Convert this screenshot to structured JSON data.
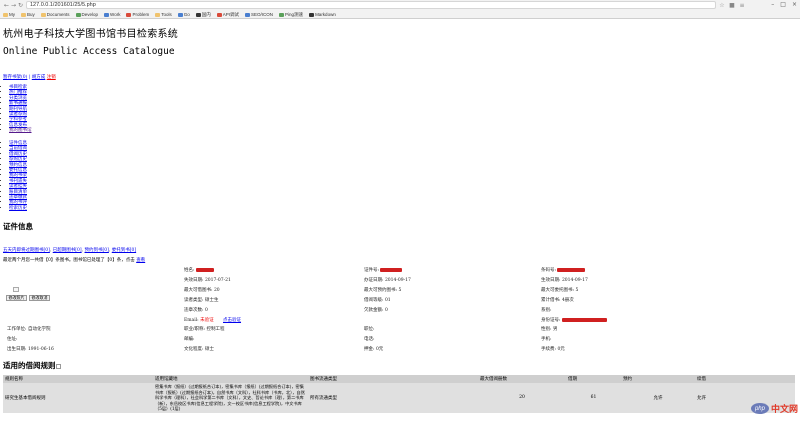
{
  "browser": {
    "url": "127.0.0.1/201601/25/5.php",
    "bookmarks": [
      "My",
      "Buy",
      "Documents",
      "Develop",
      "Work",
      "Problem",
      "Tools",
      "Go",
      "国内",
      "API调试",
      "SEO/ICON",
      "Ping测速",
      "Markdown"
    ]
  },
  "page": {
    "title_cn": "杭州电子科技大学图书馆书目检索系统",
    "title_en": "Online Public Access Catalogue",
    "top_links": {
      "register": "暂存书架(0)",
      "sep": "|",
      "user": "胡方成",
      "logout": "注销"
    },
    "menu1": [
      "书目检索",
      "热门推荐",
      "分类浏览",
      "新书通报",
      "期刊导航",
      "读者荐购",
      "学科参考",
      "信息发布",
      "我的图书馆"
    ],
    "menu2": [
      "证件信息",
      "当前借阅",
      "借阅历史",
      "荐购历史",
      "预约信息",
      "委托信息",
      "我的书架",
      "书刊遗失",
      "读者挂失",
      "账目清单",
      "违章缴款",
      "我的书评",
      "检索历史"
    ],
    "section_cert": "证件信息",
    "alert_links": [
      "五天内即将过期图书[0]",
      "已超期图书[0]",
      "预约到书[0]",
      "委托到书[0]"
    ],
    "alert_seps": [
      ",",
      ",",
      ","
    ],
    "notice": {
      "pre": "最近两个月您一共借【",
      "count1": "0",
      "mid1": "】条图书。图书馆已处理了【",
      "count2": "0",
      "post": "】条，点击"
    },
    "notice_link": "查看",
    "buttons": {
      "change_photo": "修改照片",
      "cancel_photo": "修改取消"
    },
    "fields": {
      "name": "姓名:",
      "card_no": "证件号:",
      "barcode": "条码号:",
      "expire": "失效日期: 2017-07-21",
      "issue": "办证日期: 2014-09-17",
      "effective": "生效日期: 2014-09-17",
      "max_loan": "最大可借图书: 20",
      "max_reserve": "最大可预约图书: 5",
      "max_entrust": "最大可委托图书: 5",
      "reader_type": "读者类型: 硕士生",
      "level": "借阅等级: 01",
      "total_loan": "累计借书: 4册次",
      "violations": "违章次数: 0",
      "fine": "欠款金额: 0",
      "department": "系别:",
      "email_label": "Email:",
      "email_status": "未验证",
      "email_verify": "点击验证",
      "id_card": "身份证号:",
      "work_unit": "工作单位: 自动化学院",
      "job": "职业/职称: 控制工程",
      "position": "职位:",
      "gender": "性别: 男",
      "address": "住址:",
      "postcode": "邮编:",
      "phone": "电话:",
      "mobile": "手机:",
      "birth": "出生日期: 1991-06-16",
      "education": "文化程度: 硕士",
      "deposit": "押金: 0元",
      "fee": "手续费: 0元"
    },
    "section_rules": "适用的借阅规则"
  },
  "rules_table": {
    "headers": [
      "规则名称",
      "适用馆藏地",
      "图书流通类型",
      "最大借阅册数",
      "借期",
      "预约",
      "续借"
    ],
    "rows": [
      {
        "name": "研究生基本借阅规则",
        "locations": "密集书库（报纸）(过期报纸合订本)，密集书库（报纸）(过期报纸合订本)，密集书库（报纸）(过期报纸合订本)，自然书库（文科），社科书库（书库，北），自然科学书库（理科），社会科学第二书库（文科），文史、哲论书库（理），第二书库（新），东岳校区书库(信息工程学院)，文一校区书库(信息工程学院)，中文书库（5层）(1层)",
        "type": "所有流通类型",
        "max": "20",
        "days": "61",
        "reserve": "允许",
        "renew": "允许"
      }
    ]
  },
  "watermark": {
    "logo": "php",
    "site": "中文网"
  }
}
